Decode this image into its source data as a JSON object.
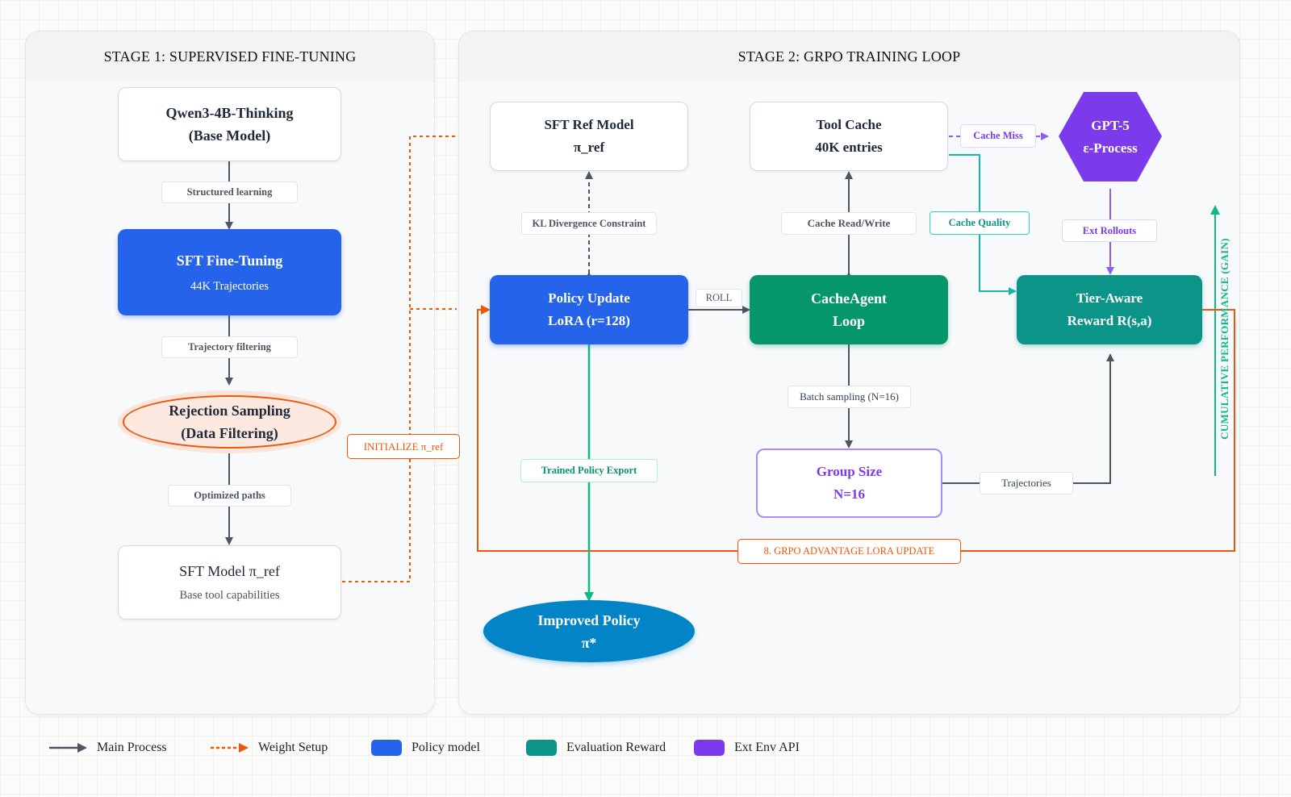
{
  "stage1": {
    "title": "STAGE 1: SUPERVISED FINE-TUNING",
    "base_model": {
      "line1": "Qwen3-4B-Thinking",
      "line2": "(Base Model)"
    },
    "label_structured": "Structured learning",
    "sft_finetune": {
      "line1": "SFT Fine-Tuning",
      "line2": "44K Trajectories"
    },
    "label_trajectory_filtering": "Trajectory filtering",
    "rejection_sampling": {
      "line1": "Rejection Sampling",
      "line2": "(Data Filtering)"
    },
    "label_optimized": "Optimized paths",
    "sft_model": {
      "line1": "SFT Model π_ref",
      "line2": "Base tool capabilities"
    }
  },
  "initialize_label": "INITIALIZE π_ref",
  "stage2": {
    "title": "STAGE 2: GRPO TRAINING LOOP",
    "sft_ref": {
      "line1": "SFT Ref Model",
      "line2": "π_ref"
    },
    "tool_cache": {
      "line1": "Tool Cache",
      "line2": "40K entries"
    },
    "gpt5": {
      "line1": "GPT-5",
      "line2": "ε-Process"
    },
    "label_cache_miss": "Cache Miss",
    "label_kl": "KL Divergence Constraint",
    "label_cache_rw": "Cache Read/Write",
    "label_cache_quality": "Cache Quality",
    "label_ext_rollouts": "Ext Rollouts",
    "policy_update": {
      "line1": "Policy Update",
      "line2": "LoRA (r=128)"
    },
    "label_roll": "ROLL",
    "cacheagent": {
      "line1": "CacheAgent",
      "line2": "Loop"
    },
    "tier_reward": {
      "line1": "Tier-Aware",
      "line2": "Reward R(s,a)"
    },
    "label_cumulative": "CUMULATIVE PERFORMANCE (GAIN)",
    "label_batch": "Batch sampling (N=16)",
    "label_trained_export": "Trained Policy Export",
    "group_size": {
      "line1": "Group Size",
      "line2": "N=16"
    },
    "label_trajectories": "Trajectories",
    "label_grpo_update": "8. GRPO ADVANTAGE LORA UPDATE",
    "improved_policy": {
      "line1": "Improved Policy",
      "line2": "π*"
    }
  },
  "legend": [
    {
      "label": "Main Process",
      "icon": "solid-arrow-icon"
    },
    {
      "label": "Weight Setup",
      "icon": "dashed-arrow-icon"
    },
    {
      "label": "Policy model",
      "color": "#2563eb"
    },
    {
      "label": "Evaluation Reward",
      "color": "#0d9488"
    },
    {
      "label": "Ext Env API",
      "color": "#7c3aed"
    }
  ],
  "colors": {
    "policy_blue": "#2563eb",
    "cacheagent_green": "#059669",
    "reward_teal": "#0d9488",
    "ext_purple": "#7c3aed",
    "weight_orange": "#ea580c",
    "export_green": "#10b981",
    "improved_blue": "#0284c7",
    "main_gray": "#4b5563"
  }
}
